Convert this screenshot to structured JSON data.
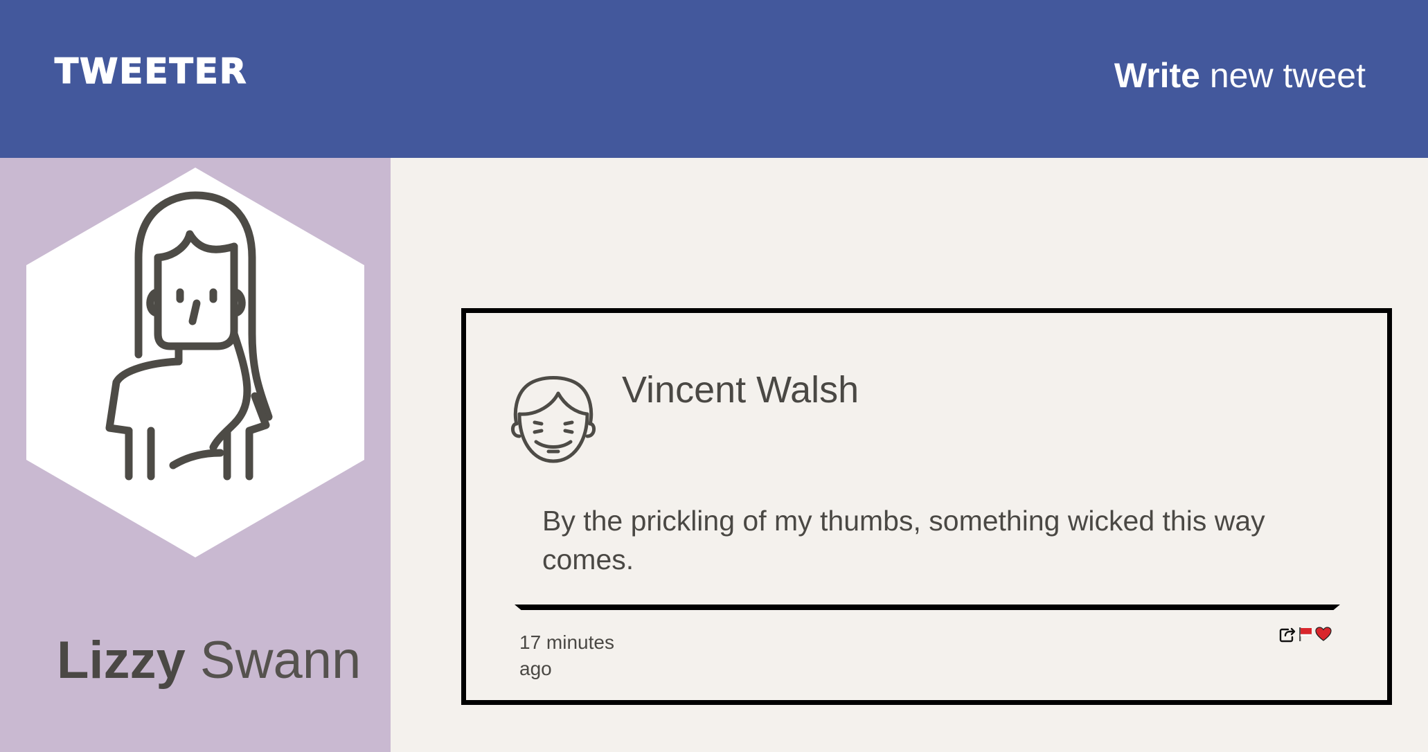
{
  "header": {
    "logo": "TWEETER",
    "write_strong": "Write",
    "write_rest": " new tweet"
  },
  "profile": {
    "first_name": "Lizzy",
    "last_name": " Swann",
    "avatar_icon": "woman-avatar-icon"
  },
  "tweet": {
    "author": "Vincent Walsh",
    "avatar_icon": "man-avatar-icon",
    "text": "By the prickling of my thumbs, something wicked this way comes.",
    "time": "17 minutes ago",
    "actions": [
      {
        "icon": "retweet-icon"
      },
      {
        "icon": "flag-icon",
        "color": "#d9262c"
      },
      {
        "icon": "heart-icon",
        "color": "#d9262c"
      }
    ]
  },
  "colors": {
    "header_bg": "#43589c",
    "sidebar_bg": "#c9b9d1",
    "page_bg": "#f4f1ed",
    "ink": "#4a4844"
  }
}
